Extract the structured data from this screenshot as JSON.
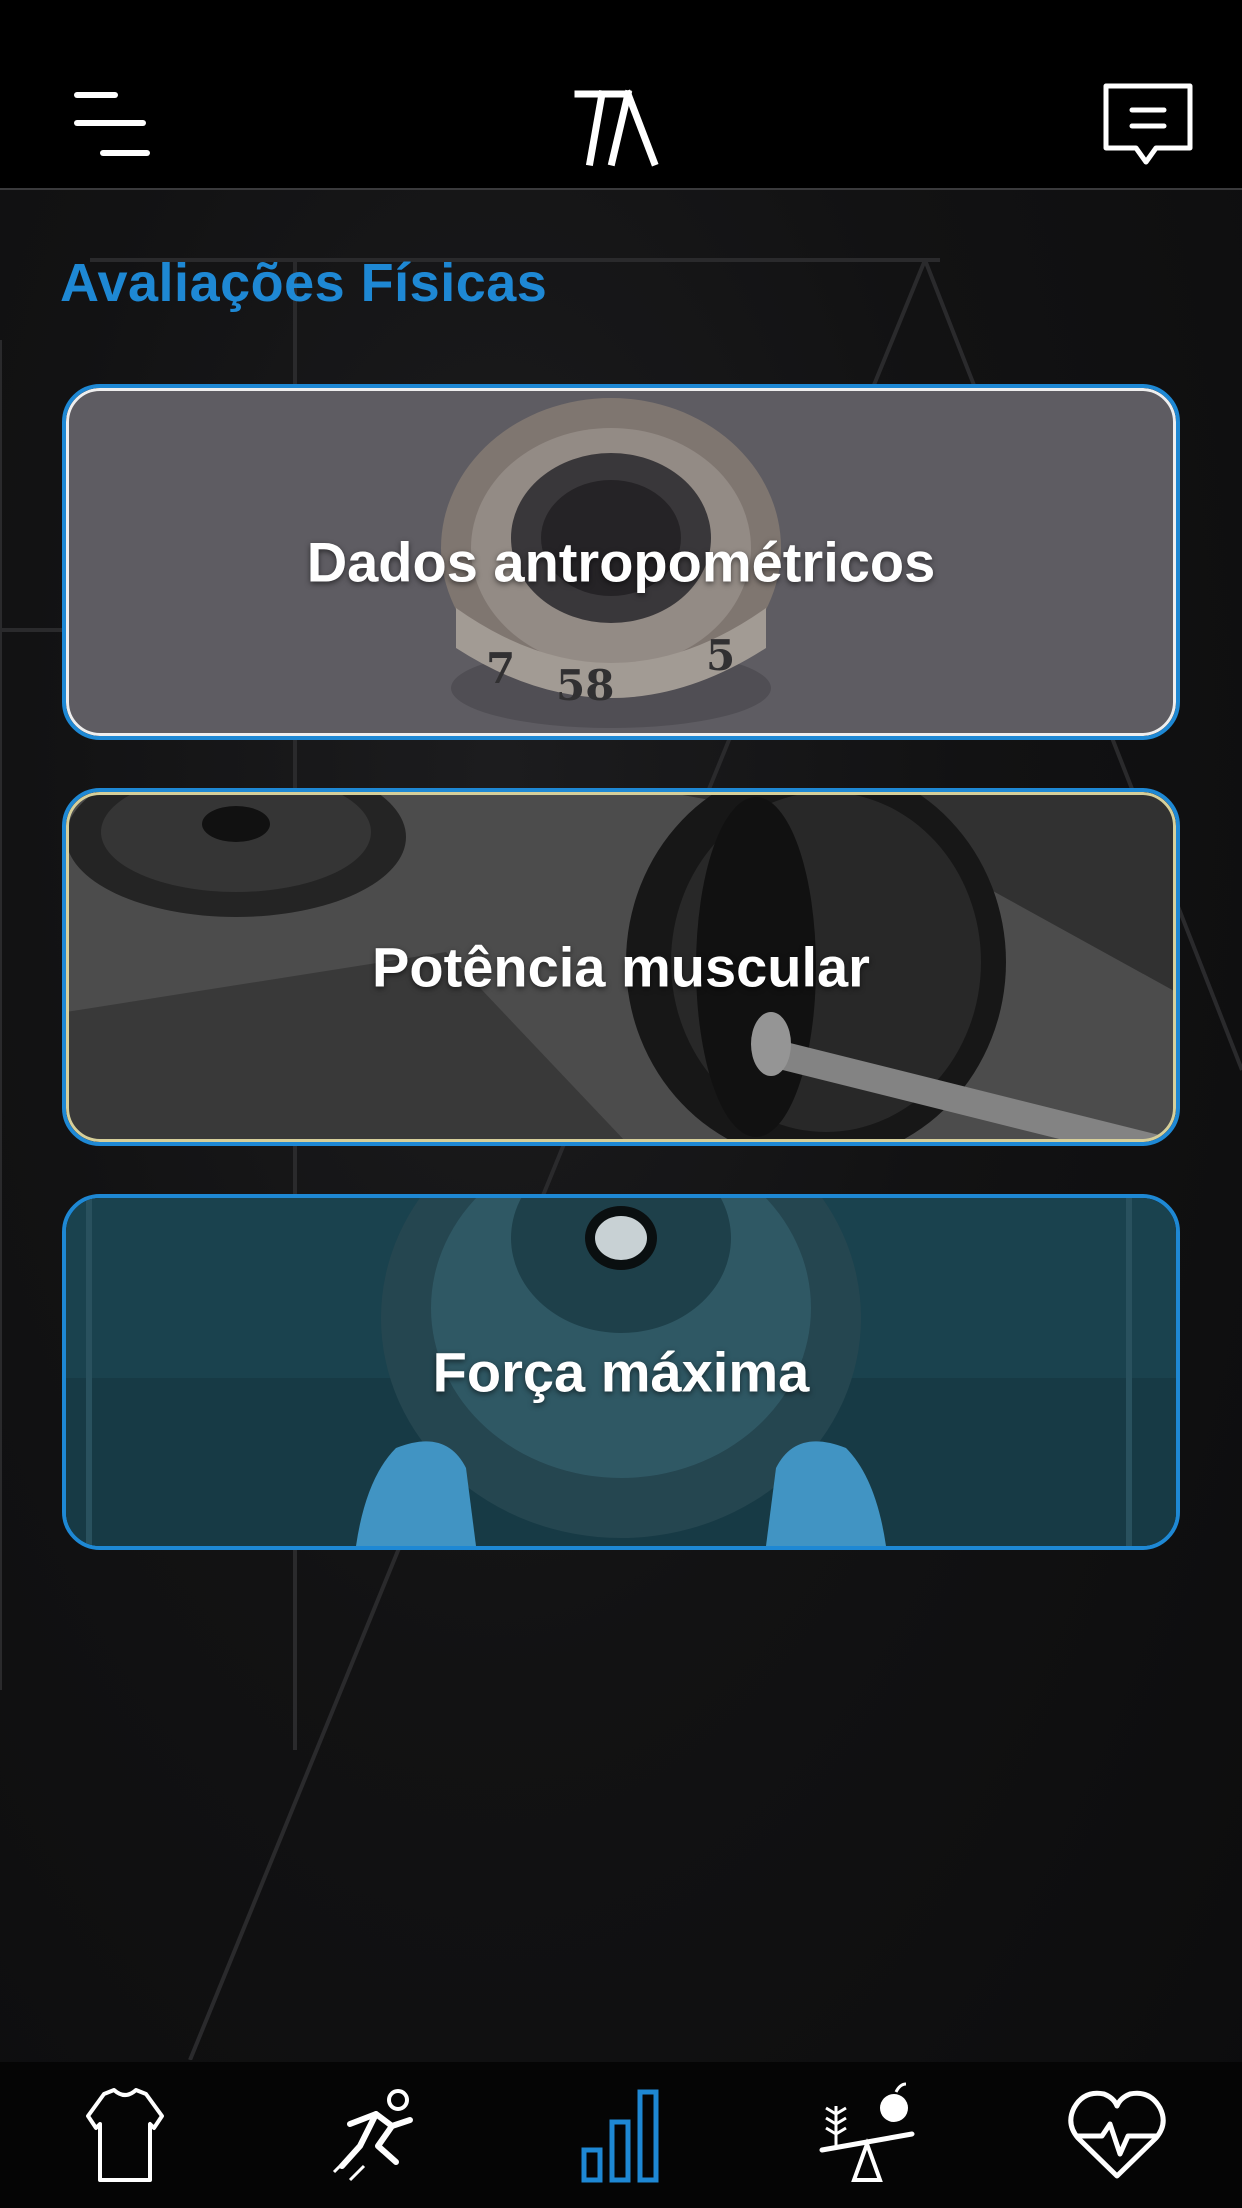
{
  "header": {
    "menu_icon": "hamburger-menu-icon",
    "logo_icon": "ta-logo-icon",
    "chat_icon": "chat-bubble-icon"
  },
  "page": {
    "title": "Avaliações Físicas"
  },
  "cards": [
    {
      "label": "Dados antropométricos",
      "image": "tape-measure-photo"
    },
    {
      "label": "Potência muscular",
      "image": "barbell-plates-photo"
    },
    {
      "label": "Força máxima",
      "image": "weight-plate-sneakers-photo"
    }
  ],
  "bottom_nav": {
    "items": [
      {
        "icon": "tshirt-icon",
        "active": false
      },
      {
        "icon": "running-ball-icon",
        "active": false
      },
      {
        "icon": "bar-chart-icon",
        "active": true
      },
      {
        "icon": "nutrition-balance-icon",
        "active": false
      },
      {
        "icon": "heart-pulse-icon",
        "active": false
      }
    ]
  },
  "colors": {
    "accent": "#1e88d4",
    "background": "#121213",
    "nav_icon": "#ffffff"
  }
}
